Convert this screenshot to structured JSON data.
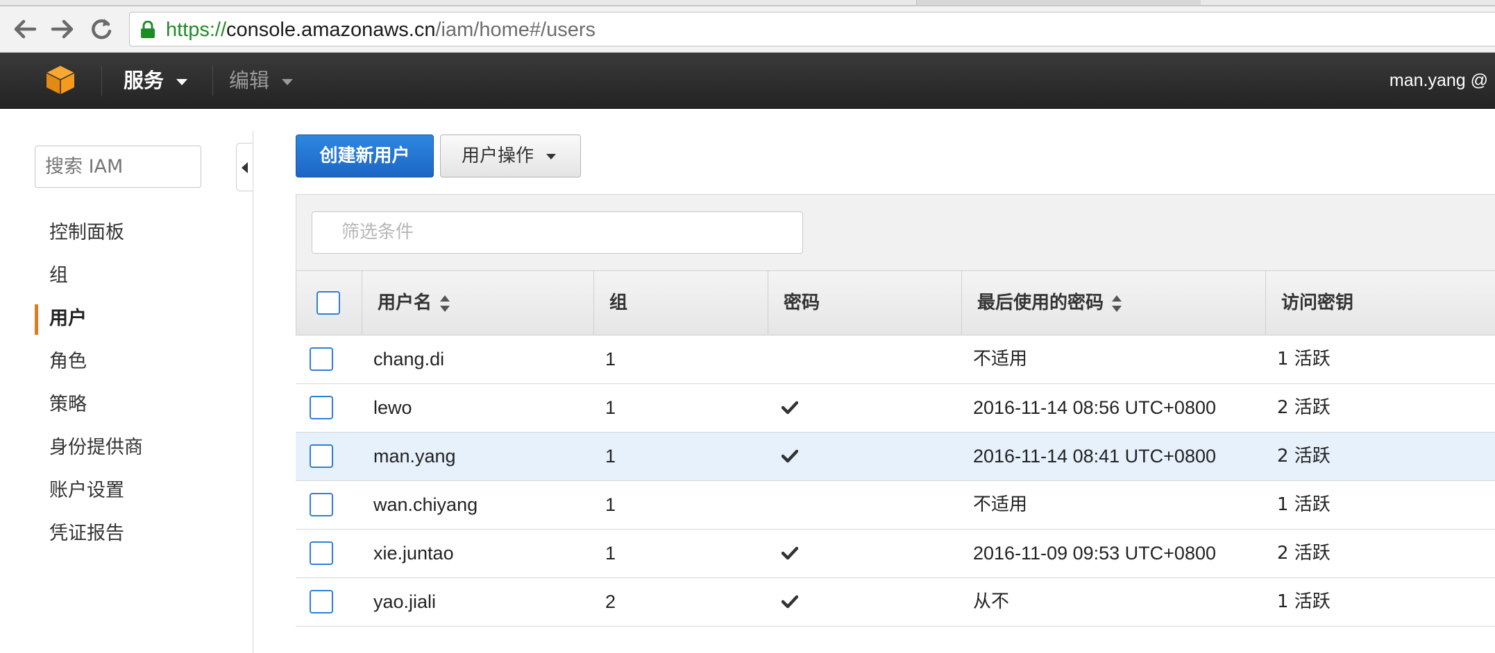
{
  "browser": {
    "url_protocol": "https://",
    "url_host": "console.amazonaws.cn",
    "url_path": "/iam/home#/users"
  },
  "navbar": {
    "services_label": "服务",
    "edit_label": "编辑",
    "user_label": "man.yang @"
  },
  "sidebar": {
    "search_placeholder": "搜索 IAM",
    "items": [
      {
        "label": "控制面板",
        "active": false
      },
      {
        "label": "组",
        "active": false
      },
      {
        "label": "用户",
        "active": true
      },
      {
        "label": "角色",
        "active": false
      },
      {
        "label": "策略",
        "active": false
      },
      {
        "label": "身份提供商",
        "active": false
      },
      {
        "label": "账户设置",
        "active": false
      },
      {
        "label": "凭证报告",
        "active": false
      }
    ]
  },
  "toolbar": {
    "create_user_label": "创建新用户",
    "user_actions_label": "用户操作"
  },
  "filter": {
    "placeholder": "筛选条件"
  },
  "table": {
    "headers": {
      "username": "用户名",
      "groups": "组",
      "password": "密码",
      "last_password_use": "最后使用的密码",
      "access_keys": "访问密钥"
    },
    "rows": [
      {
        "username": "chang.di",
        "groups": "1",
        "password": false,
        "last_password_use": "不适用",
        "access_keys": "1 活跃"
      },
      {
        "username": "lewo",
        "groups": "1",
        "password": true,
        "last_password_use": "2016-11-14 08:56 UTC+0800",
        "access_keys": "2 活跃"
      },
      {
        "username": "man.yang",
        "groups": "1",
        "password": true,
        "last_password_use": "2016-11-14 08:41 UTC+0800",
        "access_keys": "2 活跃",
        "highlighted": true
      },
      {
        "username": "wan.chiyang",
        "groups": "1",
        "password": false,
        "last_password_use": "不适用",
        "access_keys": "1 活跃"
      },
      {
        "username": "xie.juntao",
        "groups": "1",
        "password": true,
        "last_password_use": "2016-11-09 09:53 UTC+0800",
        "access_keys": "2 活跃"
      },
      {
        "username": "yao.jiali",
        "groups": "2",
        "password": true,
        "last_password_use": "从不",
        "access_keys": "1 活跃"
      }
    ]
  },
  "colors": {
    "accent_orange": "#e07c1e",
    "primary_blue": "#1c66c4",
    "navbar_bg": "#232323",
    "row_highlight": "#e6f1fb"
  }
}
